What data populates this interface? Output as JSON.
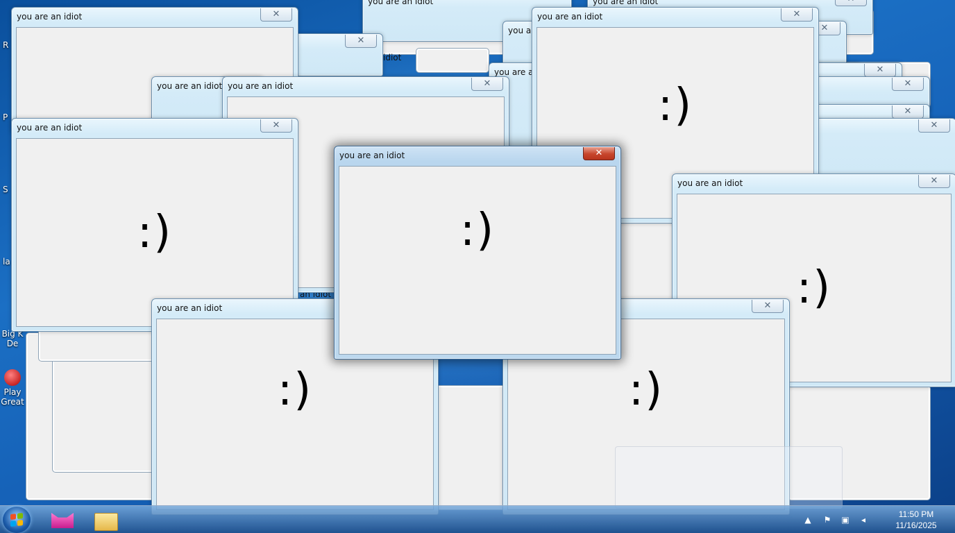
{
  "window": {
    "title": "you are an idiot",
    "face": ":)",
    "close_glyph": "✕"
  },
  "desktop_icons": [
    {
      "label": "R"
    },
    {
      "label": "P"
    },
    {
      "label": "S"
    },
    {
      "label": "la"
    },
    {
      "label": "Big K De"
    },
    {
      "label": "Play Great"
    }
  ],
  "ghost_titles": {
    "fragment_idiot": "idiot",
    "fragment_an_idiot": "an idiot"
  },
  "taskbar": {
    "apps": [
      "pink-cat-app-icon",
      "folder-icon"
    ],
    "tray": {
      "arrow": "▲",
      "flag": "⚑",
      "network": "▣",
      "volume": "◂"
    },
    "clock": {
      "time": "11:50 PM",
      "date": "11/16/2025"
    }
  },
  "colors": {
    "desktop_blue": "#1b6fc4",
    "active_close_red": "#c7452c",
    "client_bg": "#f0f0f0"
  }
}
